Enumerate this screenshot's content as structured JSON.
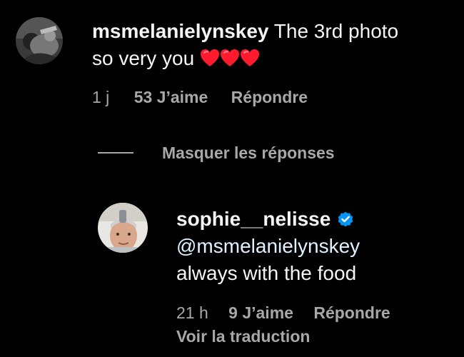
{
  "comment": {
    "username": "msmelanielynskey",
    "text_line1": " The 3rd photo",
    "text_line2": "so very you ",
    "hearts_emoji": "red-heart x3",
    "timestamp": "1 j",
    "likes": "53 J’aime",
    "reply_label": "Répondre",
    "avatar_icon": "profile-photo-msmelanielynskey"
  },
  "replies_toggle": {
    "label": "Masquer les réponses"
  },
  "reply": {
    "username": "sophie__nelisse",
    "verified": true,
    "mention": "@msmelanielynskey",
    "text": "always with the food",
    "timestamp": "21 h",
    "likes": "9 J’aime",
    "reply_label": "Répondre",
    "translate_label": "Voir la traduction",
    "avatar_icon": "profile-photo-sophie-nelisse"
  },
  "colors": {
    "background": "#000000",
    "primary_text": "#f5f5f5",
    "secondary_text": "#a8a8a8",
    "verified_blue": "#0095f6",
    "heart_red": "#ff1a2e"
  }
}
